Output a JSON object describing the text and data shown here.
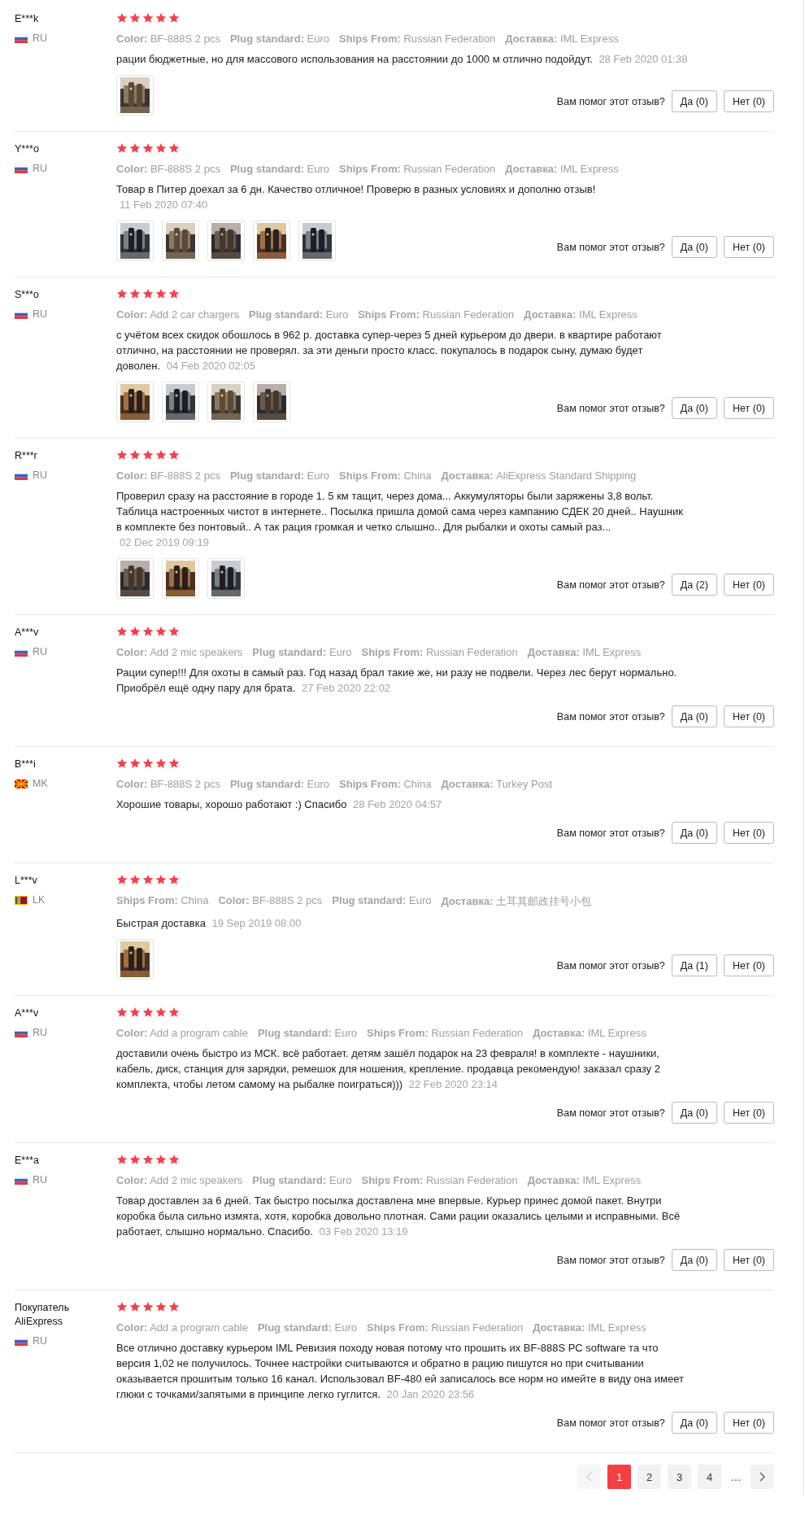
{
  "reviews": [
    {
      "user": "E***k",
      "country": "RU",
      "flag": {
        "kind": "russia"
      },
      "stars": 5,
      "attributes": [
        {
          "label": "Color:",
          "value": "BF-888S 2 pcs"
        },
        {
          "label": "Plug standard:",
          "value": "Euro"
        },
        {
          "label": "Ships From:",
          "value": "Russian Federation"
        },
        {
          "label": "Доставка:",
          "value": "IML Express"
        }
      ],
      "text": "рации бюджетные, но для массового использования на расстоянии до 1000 м отлично подойдут.",
      "date": "28 Feb 2020 01:38",
      "photos": [
        {
          "kind": "picture"
        }
      ],
      "helpful_prompt": "Вам помог этот отзыв?",
      "yes": "Да (0)",
      "no": "Нет (0)"
    },
    {
      "user": "Y***o",
      "country": "RU",
      "flag": {
        "kind": "russia"
      },
      "stars": 5,
      "attributes": [
        {
          "label": "Color:",
          "value": "BF-888S 2 pcs"
        },
        {
          "label": "Plug standard:",
          "value": "Euro"
        },
        {
          "label": "Ships From:",
          "value": "Russian Federation"
        },
        {
          "label": "Доставка:",
          "value": "IML Express"
        }
      ],
      "text": "Товар в Питер доехал за 6 дн. Качество отличное! Проверю в разных условиях и дополню отзыв!",
      "date": "11 Feb 2020 07:40",
      "photos": [
        {
          "kind": "picture"
        },
        {
          "kind": "picture"
        },
        {
          "kind": "picture"
        },
        {
          "kind": "picture"
        },
        {
          "kind": "picture"
        }
      ],
      "helpful_prompt": "Вам помог этот отзыв?",
      "yes": "Да (0)",
      "no": "Нет (0)"
    },
    {
      "user": "S***o",
      "country": "RU",
      "flag": {
        "kind": "russia"
      },
      "stars": 5,
      "attributes": [
        {
          "label": "Color:",
          "value": "Add 2 car chargers"
        },
        {
          "label": "Plug standard:",
          "value": "Euro"
        },
        {
          "label": "Ships From:",
          "value": "Russian Federation"
        },
        {
          "label": "Доставка:",
          "value": "IML Express"
        }
      ],
      "text": "с учётом всех скидок обошлось в 962 р. доставка супер-через 5 дней курьером до двери. в квартире работают отлично, на расстоянии не проверял. за эти деньги просто класс. покупалось в подарок сыну, думаю будет доволен.",
      "date": "04 Feb 2020 02:05",
      "photos": [
        {
          "kind": "picture"
        },
        {
          "kind": "picture"
        },
        {
          "kind": "picture"
        },
        {
          "kind": "picture"
        }
      ],
      "helpful_prompt": "Вам помог этот отзыв?",
      "yes": "Да (0)",
      "no": "Нет (0)"
    },
    {
      "user": "R***r",
      "country": "RU",
      "flag": {
        "kind": "russia"
      },
      "stars": 5,
      "attributes": [
        {
          "label": "Color:",
          "value": "BF-888S 2 pcs"
        },
        {
          "label": "Plug standard:",
          "value": "Euro"
        },
        {
          "label": "Ships From:",
          "value": "China"
        },
        {
          "label": "Доставка:",
          "value": "AliExpress Standard Shipping"
        }
      ],
      "text": "Проверил сразу на расстояние в городе 1. 5 км тащит, через дома... Аккумуляторы были заряжены 3,8 вольт. Таблица настроенных чистот в интернете.. Посылка пришла домой сама через кампанию СДЕК 20 дней.. Наушник в комплекте без понтовый.. А так рация громкая и четко слышно.. Для рыбалки и охоты самый раз...",
      "date": "02 Dec 2019 09:19",
      "photos": [
        {
          "kind": "picture"
        },
        {
          "kind": "picture"
        },
        {
          "kind": "picture"
        }
      ],
      "helpful_prompt": "Вам помог этот отзыв?",
      "yes": "Да (2)",
      "no": "Нет (0)"
    },
    {
      "user": "A***v",
      "country": "RU",
      "flag": {
        "kind": "russia"
      },
      "stars": 5,
      "attributes": [
        {
          "label": "Color:",
          "value": "Add 2 mic speakers"
        },
        {
          "label": "Plug standard:",
          "value": "Euro"
        },
        {
          "label": "Ships From:",
          "value": "Russian Federation"
        },
        {
          "label": "Доставка:",
          "value": "IML Express"
        }
      ],
      "text": "Рации супер!!! Для охоты в самый раз. Год назад брал такие же, ни разу не подвели. Через лес берут нормально. Приобрёл ещё одну пару для брата.",
      "date": "27 Feb 2020 22:02",
      "helpful_prompt": "Вам помог этот отзыв?",
      "yes": "Да (0)",
      "no": "Нет (0)"
    },
    {
      "user": "B***i",
      "country": "MK",
      "flag": {
        "kind": "macedonia"
      },
      "stars": 5,
      "attributes": [
        {
          "label": "Color:",
          "value": "BF-888S 2 pcs"
        },
        {
          "label": "Plug standard:",
          "value": "Euro"
        },
        {
          "label": "Ships From:",
          "value": "China"
        },
        {
          "label": "Доставка:",
          "value": "Turkey Post"
        }
      ],
      "text": "Хорошие товары, хорошо работают :) Спасибо",
      "date": "28 Feb 2020 04:57",
      "helpful_prompt": "Вам помог этот отзыв?",
      "yes": "Да (0)",
      "no": "Нет (0)"
    },
    {
      "user": "L***v",
      "country": "LK",
      "flag": {
        "kind": "srilanka"
      },
      "stars": 5,
      "attributes": [
        {
          "label": "Ships From:",
          "value": "China"
        },
        {
          "label": "Color:",
          "value": "BF-888S 2 pcs"
        },
        {
          "label": "Plug standard:",
          "value": "Euro"
        },
        {
          "label": "Доставка:",
          "value": "土耳其邮政挂号小包"
        }
      ],
      "text": "Быстрая доставка",
      "date": "19 Sep 2019 08:00",
      "photos": [
        {
          "kind": "picture"
        }
      ],
      "helpful_prompt": "Вам помог этот отзыв?",
      "yes": "Да (1)",
      "no": "Нет (0)"
    },
    {
      "user": "A***v",
      "country": "RU",
      "flag": {
        "kind": "russia"
      },
      "stars": 5,
      "attributes": [
        {
          "label": "Color:",
          "value": "Add a program cable"
        },
        {
          "label": "Plug standard:",
          "value": "Euro"
        },
        {
          "label": "Ships From:",
          "value": "Russian Federation"
        },
        {
          "label": "Доставка:",
          "value": "IML Express"
        }
      ],
      "text": "доставили очень быстро из МСК. всё работает. детям зашёл подарок на 23 февраля! в комплекте - наушники, кабель, диск, станция для зарядки, ремешок для ношения, крепление. продавца рекомендую! заказал сразу 2 комплекта, чтобы летом самому на рыбалке поиграться)))",
      "date": "22 Feb 2020 23:14",
      "helpful_prompt": "Вам помог этот отзыв?",
      "yes": "Да (0)",
      "no": "Нет (0)"
    },
    {
      "user": "E***a",
      "country": "RU",
      "flag": {
        "kind": "russia"
      },
      "stars": 5,
      "attributes": [
        {
          "label": "Color:",
          "value": "Add 2 mic speakers"
        },
        {
          "label": "Plug standard:",
          "value": "Euro"
        },
        {
          "label": "Ships From:",
          "value": "Russian Federation"
        },
        {
          "label": "Доставка:",
          "value": "IML Express"
        }
      ],
      "text": "Товар доставлен за 6 дней. Так быстро посылка доставлена мне впервые. Курьер принес домой пакет. Внутри коробка была сильно измята, хотя, коробка довольно плотная. Сами рации оказались целыми и исправными. Всё работает, слышно нормально. Спасибо.",
      "date": "03 Feb 2020 13:19",
      "helpful_prompt": "Вам помог этот отзыв?",
      "yes": "Да (0)",
      "no": "Нет (0)"
    },
    {
      "user": "Покупатель AliExpress",
      "country": "RU",
      "flag": {
        "kind": "russia"
      },
      "stars": 5,
      "attributes": [
        {
          "label": "Color:",
          "value": "Add a program cable"
        },
        {
          "label": "Plug standard:",
          "value": "Euro"
        },
        {
          "label": "Ships From:",
          "value": "Russian Federation"
        },
        {
          "label": "Доставка:",
          "value": "IML Express"
        }
      ],
      "text": "Все отлично доставку курьером IML Ревизия походу новая потому что прошить их BF-888S PC software та что версия 1,02 не получилось. Точнее настройки считываются и обратно в рацию пишутся но при считывании оказывается прошитым только 16 канал. Использовал BF-480 ей записалось все норм но имейте в виду она имеет глюки с точками/запятыми в принципе легко гуглится.",
      "date": "20 Jan 2020 23:56",
      "helpful_prompt": "Вам помог этот отзыв?",
      "yes": "Да (0)",
      "no": "Нет (0)"
    }
  ],
  "pagination": {
    "prev": {
      "disabled": true
    },
    "pages": [
      {
        "label": "1",
        "selected": true
      },
      {
        "label": "2",
        "selected": false
      },
      {
        "label": "3",
        "selected": false
      },
      {
        "label": "4",
        "selected": false
      }
    ],
    "ellipsis": "…",
    "next": {
      "disabled": false
    }
  }
}
